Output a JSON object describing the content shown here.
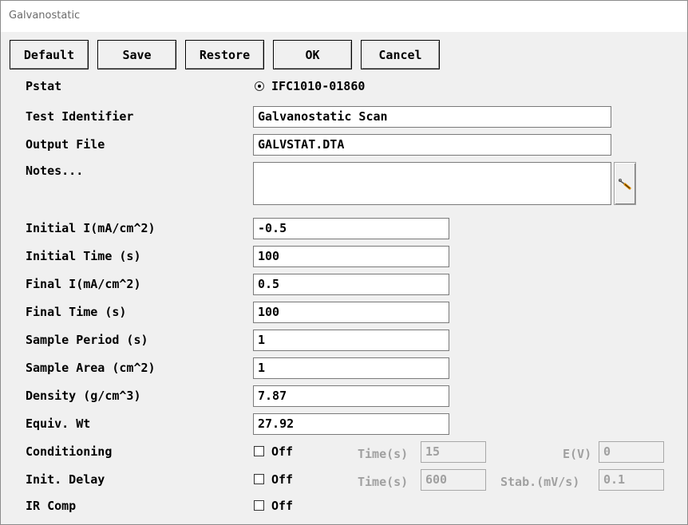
{
  "window": {
    "title": "Galvanostatic"
  },
  "toolbar": {
    "default_label": "Default",
    "save_label": "Save",
    "restore_label": "Restore",
    "ok_label": "OK",
    "cancel_label": "Cancel"
  },
  "pstat": {
    "label": "Pstat",
    "option": "IFC1010-01860",
    "selected": true
  },
  "test_identifier": {
    "label": "Test Identifier",
    "value": "Galvanostatic Scan"
  },
  "output_file": {
    "label": "Output File",
    "value": "GALVSTAT.DTA"
  },
  "notes": {
    "label": "Notes...",
    "value": "",
    "edit_icon": "screwdriver-icon"
  },
  "params": {
    "initial_i": {
      "label": "Initial I(mA/cm^2)",
      "value": "-0.5"
    },
    "initial_time": {
      "label": "Initial Time (s)",
      "value": "100"
    },
    "final_i": {
      "label": "Final I(mA/cm^2)",
      "value": "0.5"
    },
    "final_time": {
      "label": "Final Time (s)",
      "value": "100"
    },
    "sample_period": {
      "label": "Sample Period (s)",
      "value": "1"
    },
    "sample_area": {
      "label": "Sample Area (cm^2)",
      "value": "1"
    },
    "density": {
      "label": "Density (g/cm^3)",
      "value": "7.87"
    },
    "equiv_wt": {
      "label": "Equiv. Wt",
      "value": "27.92"
    }
  },
  "conditioning": {
    "label": "Conditioning",
    "checked": false,
    "state_label": "Off",
    "time_label": "Time(s)",
    "time_value": "15",
    "e_label": "E(V)",
    "e_value": "0"
  },
  "init_delay": {
    "label": "Init. Delay",
    "checked": false,
    "state_label": "Off",
    "time_label": "Time(s)",
    "time_value": "600",
    "stab_label": "Stab.(mV/s)",
    "stab_value": "0.1"
  },
  "ir_comp": {
    "label": "IR Comp",
    "checked": false,
    "state_label": "Off"
  }
}
